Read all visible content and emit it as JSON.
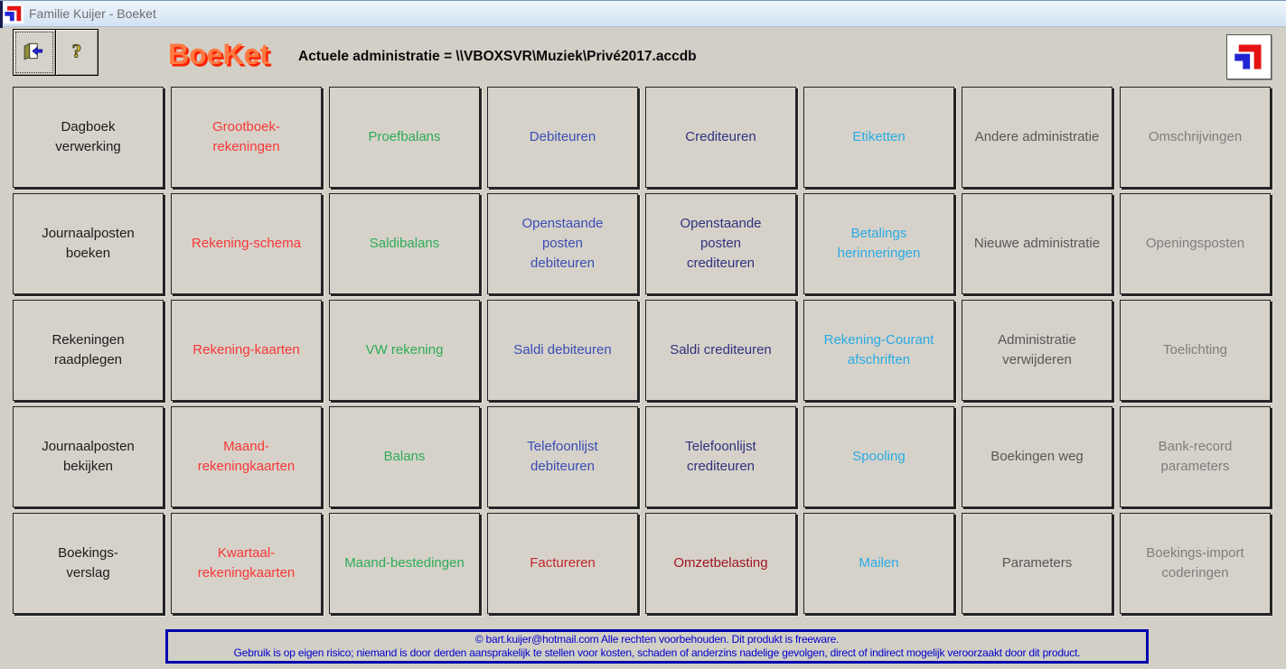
{
  "window": {
    "title": "Familie Kuijer - Boeket"
  },
  "header": {
    "logo": "BoeKet",
    "admin_text": "Actuele administratie = \\\\VBOXSVR\\Muziek\\Privé2017.accdb",
    "exit_icon": "exit-door-icon",
    "help_icon": "question-mark-icon",
    "corner_icon": "boeket-logo-icon"
  },
  "colors": {
    "black": "#1c1c1c",
    "red": "#f83737",
    "green": "#2eac57",
    "blue": "#3a4db4",
    "navy": "#31317e",
    "cyan": "#29abe3",
    "darkgray": "#575757",
    "gray": "#7e7e7e",
    "crimson": "#c0262c",
    "darkred": "#a01622"
  },
  "grid": {
    "buttons": [
      {
        "id": "dagboek-verwerking",
        "label": "Dagboek\nverwerking",
        "color": "black"
      },
      {
        "id": "grootboek-rekeningen",
        "label": "Grootboek-\nrekeningen",
        "color": "red"
      },
      {
        "id": "proefbalans",
        "label": "Proefbalans",
        "color": "green"
      },
      {
        "id": "debiteuren",
        "label": "Debiteuren",
        "color": "blue"
      },
      {
        "id": "crediteuren",
        "label": "Crediteuren",
        "color": "navy"
      },
      {
        "id": "etiketten",
        "label": "Etiketten",
        "color": "cyan"
      },
      {
        "id": "andere-administratie",
        "label": "Andere administratie",
        "color": "darkgray"
      },
      {
        "id": "omschrijvingen",
        "label": "Omschrijvingen",
        "color": "gray"
      },
      {
        "id": "journaalposten-boeken",
        "label": "Journaalposten\nboeken",
        "color": "black"
      },
      {
        "id": "rekening-schema",
        "label": "Rekening-schema",
        "color": "red"
      },
      {
        "id": "saldibalans",
        "label": "Saldibalans",
        "color": "green"
      },
      {
        "id": "openstaande-posten-debiteuren",
        "label": "Openstaande\nposten\ndebiteuren",
        "color": "blue"
      },
      {
        "id": "openstaande-posten-crediteuren",
        "label": "Openstaande\nposten\ncrediteuren",
        "color": "navy"
      },
      {
        "id": "betalings-herinneringen",
        "label": "Betalings\nherinneringen",
        "color": "cyan"
      },
      {
        "id": "nieuwe-administratie",
        "label": "Nieuwe administratie",
        "color": "darkgray"
      },
      {
        "id": "openingsposten",
        "label": "Openingsposten",
        "color": "gray"
      },
      {
        "id": "rekeningen-raadplegen",
        "label": "Rekeningen\nraadplegen",
        "color": "black"
      },
      {
        "id": "rekening-kaarten",
        "label": "Rekening-kaarten",
        "color": "red"
      },
      {
        "id": "vw-rekening",
        "label": "VW rekening",
        "color": "green"
      },
      {
        "id": "saldi-debiteuren",
        "label": "Saldi debiteuren",
        "color": "blue"
      },
      {
        "id": "saldi-crediteuren",
        "label": "Saldi crediteuren",
        "color": "navy"
      },
      {
        "id": "rekening-courant-afschriften",
        "label": "Rekening-Courant\nafschriften",
        "color": "cyan"
      },
      {
        "id": "administratie-verwijderen",
        "label": "Administratie\nverwijderen",
        "color": "darkgray"
      },
      {
        "id": "toelichting",
        "label": "Toelichting",
        "color": "gray"
      },
      {
        "id": "journaalposten-bekijken",
        "label": "Journaalposten\nbekijken",
        "color": "black"
      },
      {
        "id": "maand-rekeningkaarten",
        "label": "Maand-\nrekeningkaarten",
        "color": "red"
      },
      {
        "id": "balans",
        "label": "Balans",
        "color": "green"
      },
      {
        "id": "telefoonlijst-debiteuren",
        "label": "Telefoonlijst\ndebiteuren",
        "color": "blue"
      },
      {
        "id": "telefoonlijst-crediteuren",
        "label": "Telefoonlijst\ncrediteuren",
        "color": "navy"
      },
      {
        "id": "spooling",
        "label": "Spooling",
        "color": "cyan"
      },
      {
        "id": "boekingen-weg",
        "label": "Boekingen weg",
        "color": "darkgray"
      },
      {
        "id": "bank-record-parameters",
        "label": "Bank-record\nparameters",
        "color": "gray"
      },
      {
        "id": "boekings-verslag",
        "label": "Boekings-\nverslag",
        "color": "black"
      },
      {
        "id": "kwartaal-rekeningkaarten",
        "label": "Kwartaal-\nrekeningkaarten",
        "color": "red"
      },
      {
        "id": "maand-bestedingen",
        "label": "Maand-bestedingen",
        "color": "green"
      },
      {
        "id": "factureren",
        "label": "Factureren",
        "color": "crimson"
      },
      {
        "id": "omzetbelasting",
        "label": "Omzetbelasting",
        "color": "darkred"
      },
      {
        "id": "mailen",
        "label": "Mailen",
        "color": "cyan"
      },
      {
        "id": "parameters",
        "label": "Parameters",
        "color": "darkgray"
      },
      {
        "id": "boekings-import-coderingen",
        "label": "Boekings-import\ncoderingen",
        "color": "gray"
      }
    ]
  },
  "footer": {
    "line1": "© bart.kuijer@hotmail.com  Alle rechten voorbehouden.  Dit produkt  is freeware.",
    "line2": "Gebruik is op eigen risico; niemand is door derden aansprakelijk te stellen voor kosten, schaden of anderzins nadelige gevolgen, direct of indirect mogelijk veroorzaakt door dit product."
  }
}
